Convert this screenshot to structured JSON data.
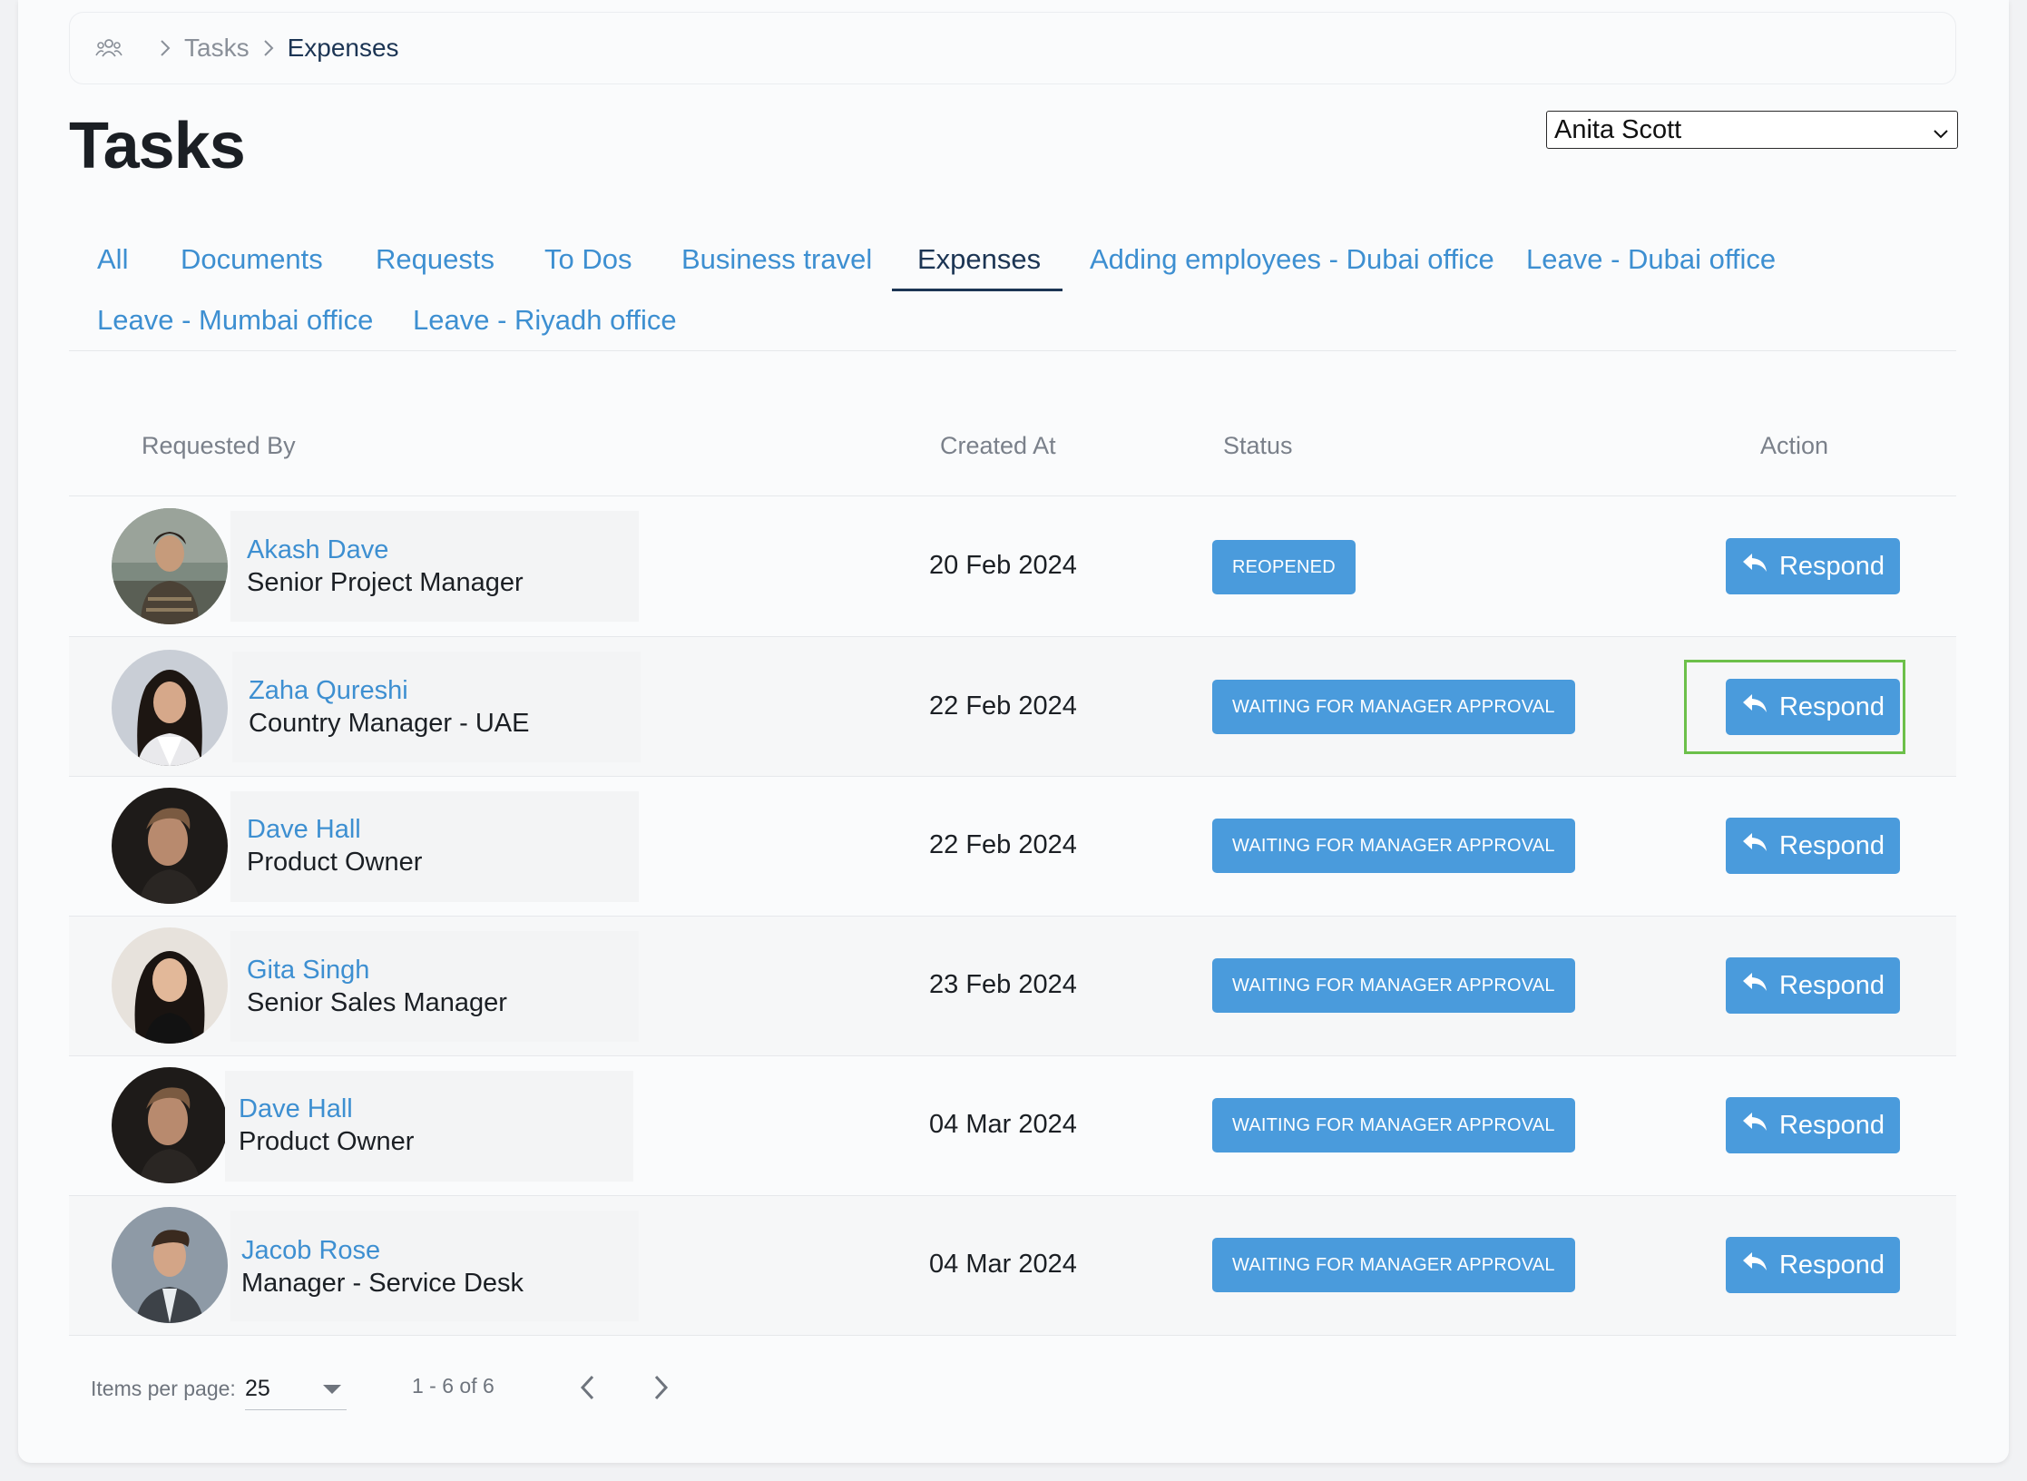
{
  "breadcrumb": {
    "items": [
      "Tasks",
      "Expenses"
    ],
    "home_icon": "people-icon"
  },
  "page": {
    "title": "Tasks"
  },
  "user_select": {
    "value": "Anita Scott"
  },
  "tabs": [
    {
      "label": "All",
      "active": false
    },
    {
      "label": "Documents",
      "active": false
    },
    {
      "label": "Requests",
      "active": false
    },
    {
      "label": "To Dos",
      "active": false
    },
    {
      "label": "Business travel",
      "active": false
    },
    {
      "label": "Expenses",
      "active": true
    },
    {
      "label": "Adding employees - Dubai office",
      "active": false
    },
    {
      "label": "Leave - Dubai office",
      "active": false
    },
    {
      "label": "Leave - Mumbai office",
      "active": false
    },
    {
      "label": "Leave - Riyadh office",
      "active": false
    }
  ],
  "table": {
    "headers": {
      "requested_by": "Requested By",
      "created_at": "Created At",
      "status": "Status",
      "action": "Action"
    },
    "rows": [
      {
        "name": "Akash Dave",
        "role": "Senior Project Manager",
        "created": "20 Feb 2024",
        "status": "REOPENED",
        "action": "Respond"
      },
      {
        "name": "Zaha Qureshi",
        "role": "Country Manager - UAE",
        "created": "22 Feb 2024",
        "status": "WAITING FOR MANAGER APPROVAL",
        "action": "Respond"
      },
      {
        "name": "Dave Hall",
        "role": "Product Owner",
        "created": "22 Feb 2024",
        "status": "WAITING FOR MANAGER APPROVAL",
        "action": "Respond"
      },
      {
        "name": "Gita Singh",
        "role": "Senior Sales Manager",
        "created": "23 Feb 2024",
        "status": "WAITING FOR MANAGER APPROVAL",
        "action": "Respond"
      },
      {
        "name": "Dave Hall",
        "role": "Product Owner",
        "created": "04 Mar 2024",
        "status": "WAITING FOR MANAGER APPROVAL",
        "action": "Respond"
      },
      {
        "name": "Jacob Rose",
        "role": "Manager - Service Desk",
        "created": "04 Mar 2024",
        "status": "WAITING FOR MANAGER APPROVAL",
        "action": "Respond"
      }
    ]
  },
  "paginator": {
    "label": "Items per page:",
    "per_page": "25",
    "range": "1 - 6 of 6"
  },
  "colors": {
    "accent": "#4a9bdc",
    "link": "#3d8fd1",
    "active_tab": "#1c3554",
    "focus": "#6cc04a"
  }
}
